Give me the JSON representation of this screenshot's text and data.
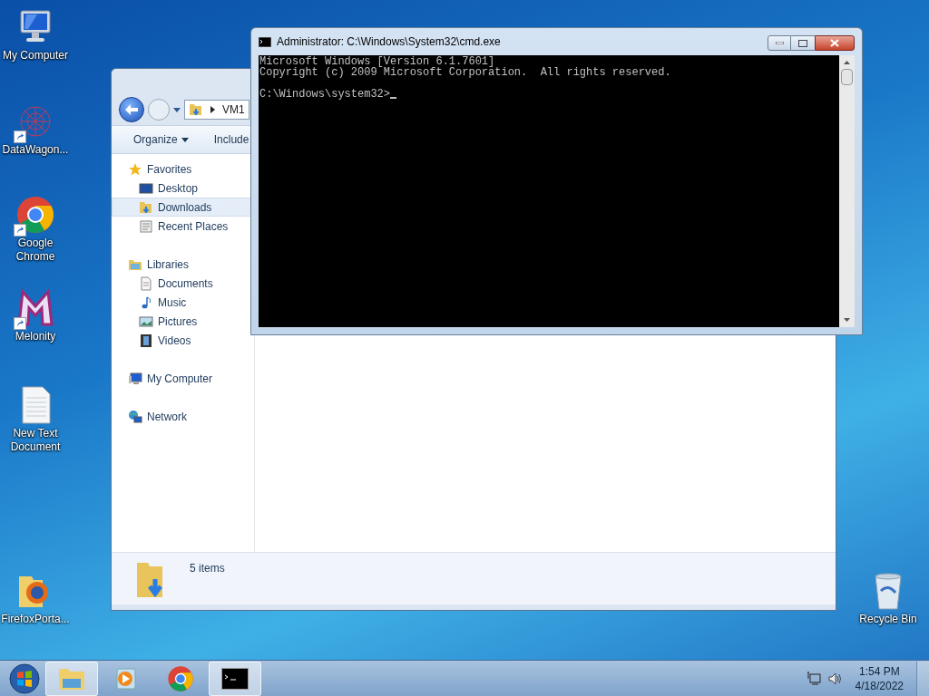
{
  "desktop_icons": [
    {
      "kind": "computer",
      "label": "My Computer",
      "shortcut": false
    },
    {
      "kind": "datawagon",
      "label": "DataWagon...",
      "shortcut": true
    },
    {
      "kind": "chrome",
      "label": "Google Chrome",
      "shortcut": true
    },
    {
      "kind": "melonity",
      "label": "Melonity",
      "shortcut": true
    },
    {
      "kind": "textfile",
      "label": "New Text Document",
      "shortcut": false
    },
    {
      "kind": "firefoxfolder",
      "label": "FirefoxPorta...",
      "shortcut": false
    },
    {
      "kind": "recycle",
      "label": "Recycle Bin",
      "shortcut": false
    }
  ],
  "explorer": {
    "address": "VM1",
    "toolbar": [
      "Organize",
      "Include"
    ],
    "nav": [
      {
        "kind": "favorites",
        "label": "Favorites",
        "children": [
          {
            "kind": "desktop",
            "label": "Desktop",
            "selected": false
          },
          {
            "kind": "downloads",
            "label": "Downloads",
            "selected": true
          },
          {
            "kind": "recent",
            "label": "Recent Places",
            "selected": false
          }
        ]
      },
      {
        "kind": "libraries",
        "label": "Libraries",
        "children": [
          {
            "kind": "documents",
            "label": "Documents",
            "selected": false
          },
          {
            "kind": "music",
            "label": "Music",
            "selected": false
          },
          {
            "kind": "pictures",
            "label": "Pictures",
            "selected": false
          },
          {
            "kind": "videos",
            "label": "Videos",
            "selected": false
          }
        ]
      },
      {
        "kind": "computer",
        "label": "My Computer"
      },
      {
        "kind": "network",
        "label": "Network"
      }
    ],
    "status": "5 items"
  },
  "cmd": {
    "title": "Administrator: C:\\Windows\\System32\\cmd.exe",
    "lines": [
      "Microsoft Windows [Version 6.1.7601]",
      "Copyright (c) 2009 Microsoft Corporation.  All rights reserved."
    ],
    "prompt": "C:\\Windows\\system32>"
  },
  "taskbar": {
    "items": [
      {
        "kind": "explorer",
        "active": true
      },
      {
        "kind": "media",
        "active": false
      },
      {
        "kind": "chrome",
        "active": false
      },
      {
        "kind": "cmd",
        "active": true
      }
    ],
    "time": "1:54 PM",
    "date": "4/18/2022"
  }
}
